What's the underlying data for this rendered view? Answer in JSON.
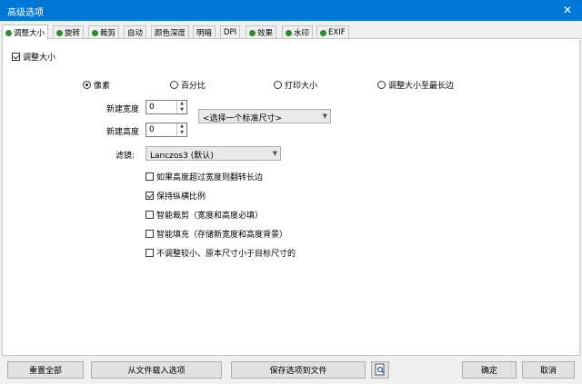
{
  "window": {
    "title": "高级选项",
    "close_glyph": "✕"
  },
  "tabs": [
    {
      "label": "调整大小",
      "active": true
    },
    {
      "label": "旋转"
    },
    {
      "label": "裁剪"
    },
    {
      "label": "自动"
    },
    {
      "label": "颜色深度"
    },
    {
      "label": "明暗"
    },
    {
      "label": "DPI"
    },
    {
      "label": "效果"
    },
    {
      "label": "水印"
    },
    {
      "label": "EXIF"
    }
  ],
  "resize": {
    "enable_label": "调整大小",
    "enable_checked": true,
    "mode_options": [
      {
        "label": "像素",
        "checked": true
      },
      {
        "label": "百分比",
        "checked": false
      },
      {
        "label": "打印大小",
        "checked": false
      },
      {
        "label": "调整大小至最长边",
        "checked": false
      }
    ],
    "new_width_label": "新建宽度",
    "new_width_value": "0",
    "new_height_label": "新建高度",
    "new_height_value": "0",
    "preset_placeholder": "<选择一个标准尺寸>",
    "filter_label": "滤镜:",
    "filter_value": "Lanczos3 (默认)",
    "options": [
      {
        "label": "如果高度超过宽度则翻转长边",
        "checked": false
      },
      {
        "label": "保持纵横比例",
        "checked": true
      },
      {
        "label": "智能裁剪（宽度和高度必填）",
        "checked": false
      },
      {
        "label": "智能填充（存储新宽度和高度背景）",
        "checked": false
      },
      {
        "label": "不调整较小、原本尺寸小于目标尺寸的",
        "checked": false
      }
    ]
  },
  "buttons": {
    "reset": "重置全部",
    "load": "从文件载入选项",
    "save": "保存选项到文件",
    "ok": "确定",
    "cancel": "取消"
  }
}
